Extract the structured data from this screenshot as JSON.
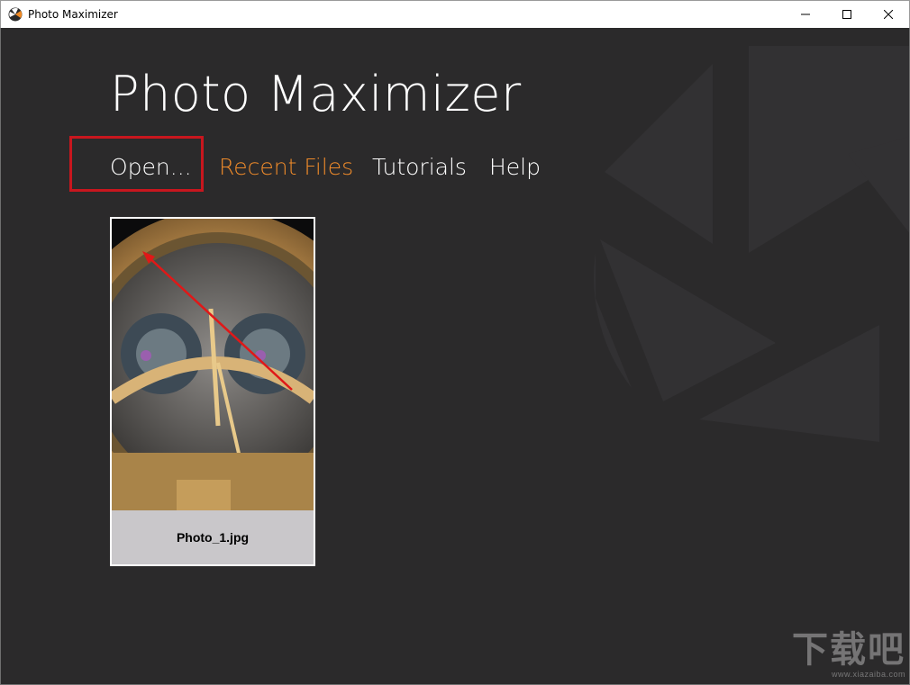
{
  "window": {
    "title": "Photo Maximizer"
  },
  "header": {
    "title": "Photo Maximizer"
  },
  "nav": {
    "open": "Open...",
    "recent_files": "Recent Files",
    "tutorials": "Tutorials",
    "help": "Help"
  },
  "recent": {
    "items": [
      {
        "filename": "Photo_1.jpg"
      }
    ]
  },
  "watermark": {
    "main": "下载吧",
    "sub": "www.xiazaiba.com"
  },
  "colors": {
    "background": "#2b2a2b",
    "accent": "#ee8a2a",
    "highlight": "#c8161e",
    "caption_bg": "#c9c7ca"
  },
  "icons": {
    "app_logo": "app-logo-icon",
    "minimize": "minimize-icon",
    "maximize": "maximize-icon",
    "close": "close-icon"
  }
}
